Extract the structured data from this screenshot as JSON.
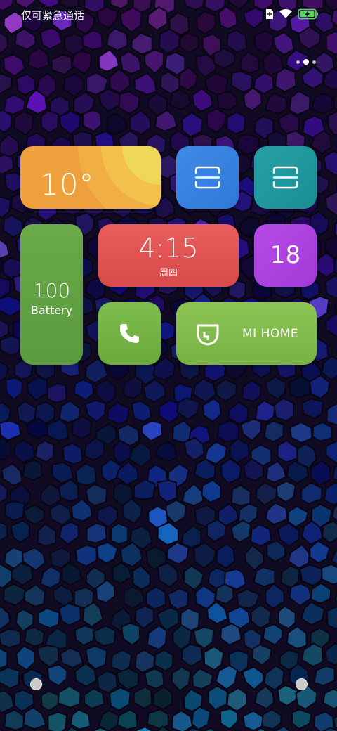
{
  "status_bar": {
    "carrier_text": "仅可紧急通话",
    "icons": [
      "sim-card-icon",
      "wifi-icon",
      "battery-charging-icon"
    ]
  },
  "home": {
    "page_indicator": {
      "pages": 3,
      "active": 1
    }
  },
  "widgets": {
    "weather": {
      "temperature": "10°",
      "color": "#eea03c"
    },
    "scan_left": {
      "icon": "scan-icon",
      "color": "#3f8be6"
    },
    "scan_right": {
      "icon": "scan-icon",
      "color": "#27a0a6"
    },
    "battery": {
      "value": "100",
      "label": "Battery",
      "color": "#6aaa48"
    },
    "clock": {
      "time": "4:15",
      "weekday": "周四",
      "color": "#ea5e5e"
    },
    "date": {
      "day": "18",
      "color": "#b64ae8"
    },
    "phone": {
      "icon": "phone-icon",
      "color": "#7dbd4c"
    },
    "mi_home": {
      "label": "MI HOME",
      "icon": "mi-home-icon",
      "color": "#8cc454"
    }
  }
}
